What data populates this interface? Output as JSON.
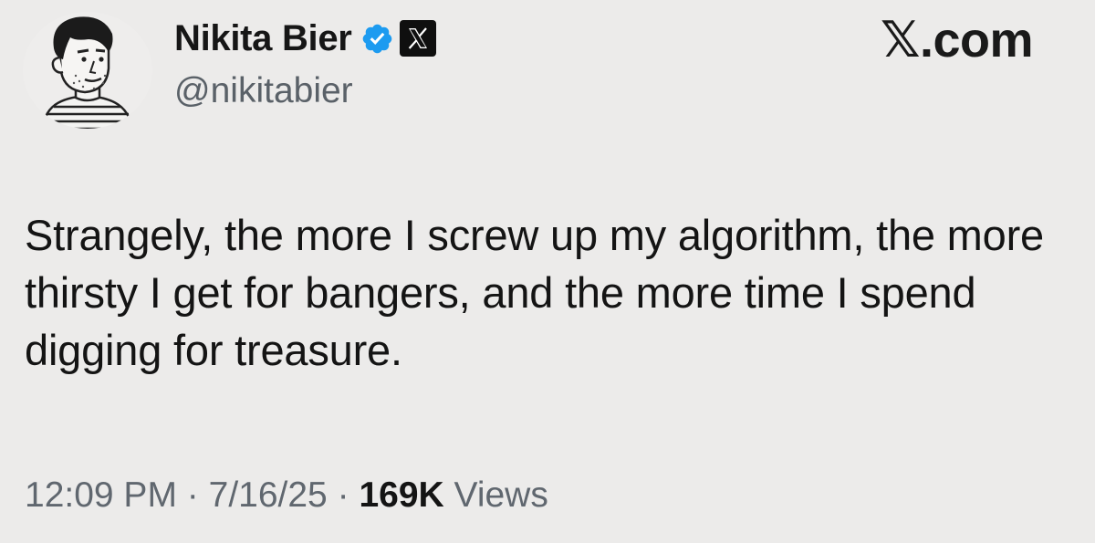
{
  "author": {
    "display_name": "Nikita Bier",
    "handle": "@nikitabier",
    "avatar": "cartoon-portrait-avatar",
    "badges": [
      "verified-checkmark-icon",
      "x-affiliation-icon"
    ]
  },
  "site_label": "𝕏.com",
  "tweet": {
    "text": "Strangely, the more I screw up my algorithm, the more thirsty I get for bangers, and the more time I spend digging for treasure."
  },
  "meta": {
    "time": "12:09 PM",
    "separator": "·",
    "date": "7/16/25",
    "views_count": "169K",
    "views_label": "Views"
  },
  "colors": {
    "background": "#ecebea",
    "text": "#141414",
    "secondary_text": "#5a6168",
    "verified_blue": "#1d9bf0"
  }
}
